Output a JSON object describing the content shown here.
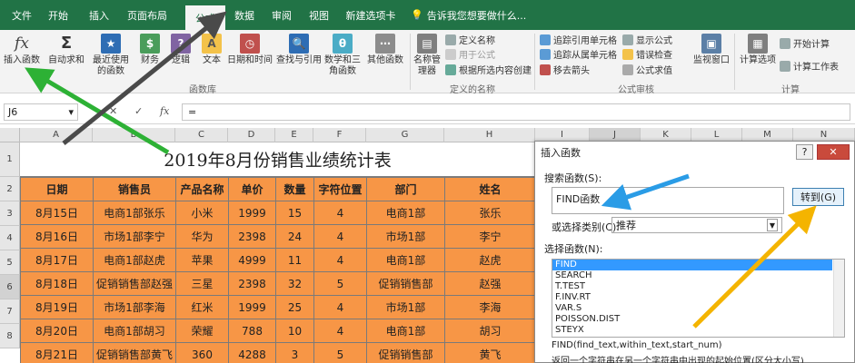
{
  "tabs": [
    "文件",
    "开始",
    "插入",
    "页面布局",
    "公式",
    "数据",
    "审阅",
    "视图",
    "新建选项卡"
  ],
  "active_tab": "公式",
  "tell_me": "告诉我您想要做什么...",
  "ribbon": {
    "insert_function": "插入函数",
    "autosum": "自动求和",
    "recent": "最近使用的函数",
    "financial": "财务",
    "logical": "逻辑",
    "text": "文本",
    "datetime": "日期和时间",
    "lookup": "查找与引用",
    "math": "数学和三角函数",
    "other": "其他函数",
    "library_label": "函数库",
    "name_manager": "名称管理器",
    "define_name": "定义名称",
    "use_in_formula": "用于公式",
    "create_from_selection": "根据所选内容创建",
    "names_label": "定义的名称",
    "trace_precedents": "追踪引用单元格",
    "trace_dependents": "追踪从属单元格",
    "remove_arrows": "移去箭头",
    "show_formulas": "显示公式",
    "error_checking": "错误检查",
    "evaluate_formula": "公式求值",
    "audit_label": "公式审核",
    "watch_window": "监视窗口",
    "calc_options": "计算选项",
    "calc_now": "开始计算",
    "calc_sheet": "计算工作表",
    "calc_label": "计算",
    "colors": {
      "green": "#217346",
      "orange": "#f79646"
    }
  },
  "formula_bar": {
    "name_box": "J6",
    "cancel": "✕",
    "enter": "✓",
    "fx": "fx",
    "formula": "="
  },
  "columns": [
    "A",
    "B",
    "C",
    "D",
    "E",
    "F",
    "G",
    "H",
    "I",
    "J",
    "K",
    "L",
    "M",
    "N"
  ],
  "rows": [
    "1",
    "2",
    "3",
    "4",
    "5",
    "6",
    "7",
    "8"
  ],
  "sheet": {
    "title": "2019年8月份销售业绩统计表",
    "headers": [
      "日期",
      "销售员",
      "产品名称",
      "单价",
      "数量",
      "字符位置",
      "部门",
      "姓名"
    ],
    "data": [
      [
        "8月15日",
        "电商1部张乐",
        "小米",
        "1999",
        "15",
        "4",
        "电商1部",
        "张乐"
      ],
      [
        "8月16日",
        "市场1部李宁",
        "华为",
        "2398",
        "24",
        "4",
        "市场1部",
        "李宁"
      ],
      [
        "8月17日",
        "电商1部赵虎",
        "苹果",
        "4999",
        "11",
        "4",
        "电商1部",
        "赵虎"
      ],
      [
        "8月18日",
        "促销销售部赵强",
        "三星",
        "2398",
        "32",
        "5",
        "促销销售部",
        "赵强"
      ],
      [
        "8月19日",
        "市场1部李海",
        "红米",
        "1999",
        "25",
        "4",
        "市场1部",
        "李海"
      ],
      [
        "8月20日",
        "电商1部胡习",
        "荣耀",
        "788",
        "10",
        "4",
        "电商1部",
        "胡习"
      ],
      [
        "8月21日",
        "促销销售部黄飞",
        "360",
        "4288",
        "3",
        "5",
        "促销销售部",
        "黄飞"
      ]
    ]
  },
  "dialog": {
    "title": "插入函数",
    "help": "?",
    "close": "✕",
    "search_label": "搜索函数(S):",
    "search_value": "FIND函数",
    "goto": "转到(G)",
    "category_label": "或选择类别(C):",
    "category_value": "推荐",
    "select_label": "选择函数(N):",
    "functions": [
      "FIND",
      "SEARCH",
      "T.TEST",
      "F.INV.RT",
      "VAR.S",
      "POISSON.DIST",
      "STEYX"
    ],
    "signature": "FIND(find_text,within_text,start_num)",
    "description": "返回一个字符串在另一个字符串中出现的起始位置(区分大小写)"
  }
}
